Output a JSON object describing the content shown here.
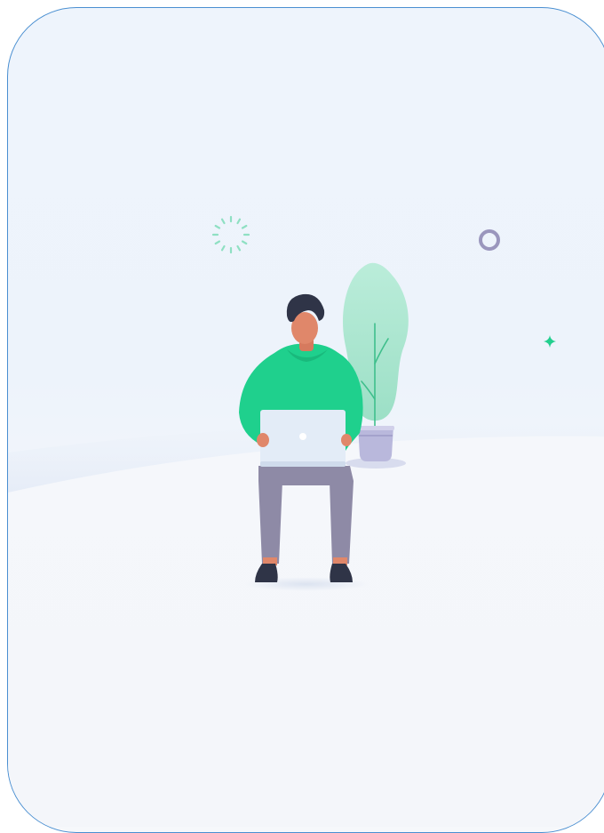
{
  "illustration": {
    "frame_color": "#4a8fd1",
    "sky_color": "#eef4fc",
    "ground_color": "#f4f6fa",
    "hoodie_color": "#1fd08d",
    "pants_color": "#8e8aa6",
    "skin_color": "#e0876a",
    "hair_color": "#2f3447",
    "laptop_color": "#e3ecf7",
    "plant_leaf_color": "#a6e6cc",
    "pot_color": "#b9b8dc",
    "icons": [
      "sparkle-burst-icon",
      "ring-icon",
      "sparkle-star-icon"
    ]
  }
}
